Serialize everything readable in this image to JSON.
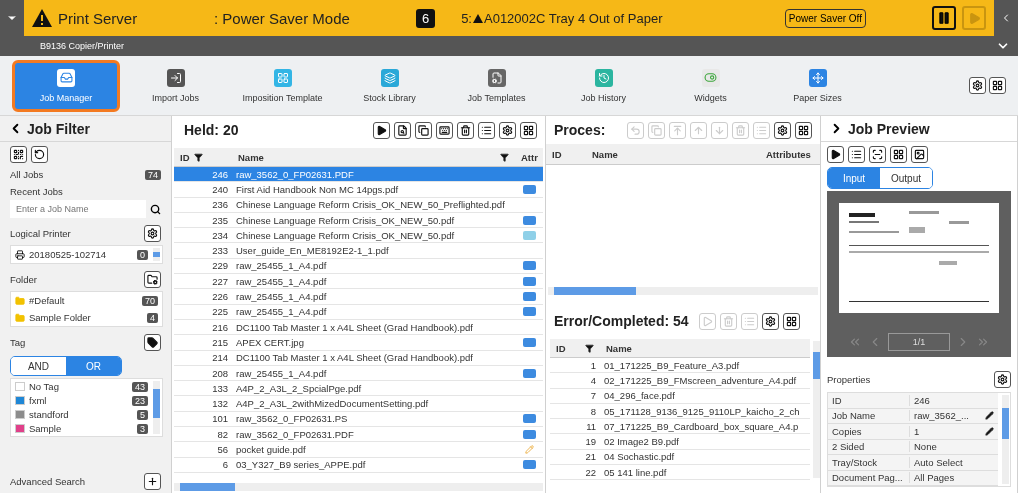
{
  "header": {
    "title": "Print Server",
    "mode": ": Power Saver Mode",
    "count": "6",
    "message_prefix": "5:",
    "message": "A012002C Tray 4 Out of Paper",
    "power_button": "Power Saver Off",
    "device": "B9136 Copier/Printer"
  },
  "toolbar": [
    {
      "label": "Job Manager",
      "kind": "manager",
      "selected": true
    },
    {
      "label": "Import Jobs",
      "kind": "import",
      "selected": false
    },
    {
      "label": "Imposition Template",
      "kind": "imposition",
      "selected": false
    },
    {
      "label": "Stock Library",
      "kind": "stock",
      "selected": false
    },
    {
      "label": "Job Templates",
      "kind": "templates",
      "selected": false
    },
    {
      "label": "Job History",
      "kind": "history",
      "selected": false
    },
    {
      "label": "Widgets",
      "kind": "widgets",
      "selected": false
    },
    {
      "label": "Paper Sizes",
      "kind": "paper",
      "selected": false
    }
  ],
  "job_filter": {
    "title": "Job Filter",
    "all_jobs": {
      "label": "All Jobs",
      "count": "74"
    },
    "recent_jobs": "Recent Jobs",
    "search_placeholder": "Enter a Job Name",
    "logical_printer": {
      "label": "Logical Printer",
      "items": [
        {
          "name": "20180525-102714",
          "count": "0"
        }
      ]
    },
    "folder": {
      "label": "Folder",
      "items": [
        {
          "name": "#Default",
          "count": "70"
        },
        {
          "name": "Sample Folder",
          "count": "4"
        }
      ]
    },
    "tag": {
      "label": "Tag",
      "modes": [
        {
          "label": "AND",
          "selected": false
        },
        {
          "label": "OR",
          "selected": true
        }
      ],
      "items": [
        {
          "name": "No Tag",
          "count": "43",
          "color": "#ffffff"
        },
        {
          "name": "fxml",
          "count": "23",
          "color": "#1f87d6"
        },
        {
          "name": "standford",
          "count": "5",
          "color": "#8c8c8c"
        },
        {
          "name": "Sample",
          "count": "3",
          "color": "#e0408a"
        }
      ]
    },
    "advanced_search": "Advanced Search"
  },
  "held": {
    "title": "Held: 20",
    "columns": [
      "ID",
      "Name",
      "Attr"
    ],
    "rows": [
      {
        "id": "246",
        "name": "raw_3562_0_FP02631.PDF",
        "kind": "plain",
        "selected": true
      },
      {
        "id": "240",
        "name": "First Aid Handbook Non MC 14pgs.pdf",
        "kind": "rdp",
        "selected": false
      },
      {
        "id": "236",
        "name": "Chinese Language Reform Crisis_OK_NEW_50_Preflighted.pdf",
        "kind": "plain",
        "selected": false
      },
      {
        "id": "235",
        "name": "Chinese Language Reform Crisis_OK_NEW_50.pdf",
        "kind": "rdp",
        "selected": false
      },
      {
        "id": "234",
        "name": "Chinese Language Reform Crisis_OK_NEW_50.pdf",
        "kind": "ps",
        "selected": false
      },
      {
        "id": "233",
        "name": "User_guide_En_ME8192E2-1_1.pdf",
        "kind": "plain",
        "selected": false
      },
      {
        "id": "229",
        "name": "raw_25455_1_A4.pdf",
        "kind": "rdp",
        "selected": false
      },
      {
        "id": "227",
        "name": "raw_25455_1_A4.pdf",
        "kind": "rdp",
        "selected": false
      },
      {
        "id": "226",
        "name": "raw_25455_1_A4.pdf",
        "kind": "rdp",
        "selected": false
      },
      {
        "id": "225",
        "name": "raw_25455_1_A4.pdf",
        "kind": "rdp",
        "selected": false
      },
      {
        "id": "216",
        "name": "DC1100 Tab Master 1 x A4L Sheet (Grad Handbook).pdf",
        "kind": "plain",
        "selected": false
      },
      {
        "id": "215",
        "name": "APEX CERT.jpg",
        "kind": "rdp",
        "selected": false
      },
      {
        "id": "214",
        "name": "DC1100 Tab Master 1 x A4L Sheet (Grad Handbook).pdf",
        "kind": "plain",
        "selected": false
      },
      {
        "id": "208",
        "name": "raw_25455_1_A4.pdf",
        "kind": "rdp",
        "selected": false
      },
      {
        "id": "133",
        "name": "A4P_2_A3L_2_SpcialPge.pdf",
        "kind": "plain",
        "selected": false
      },
      {
        "id": "132",
        "name": "A4P_2_A3L_2withMizedDocumentSetting.pdf",
        "kind": "plain",
        "selected": false
      },
      {
        "id": "101",
        "name": "raw_3562_0_FP02631.PS",
        "kind": "rdp",
        "selected": false
      },
      {
        "id": "82",
        "name": "raw_3562_0_FP02631.PDF",
        "kind": "rdp",
        "selected": false
      },
      {
        "id": "56",
        "name": "pocket guide.pdf",
        "kind": "edit",
        "selected": false
      },
      {
        "id": "6",
        "name": "03_Y327_B9 series_APPE.pdf",
        "kind": "rdp",
        "selected": false
      }
    ]
  },
  "processing": {
    "title": "Proces:",
    "columns": [
      "ID",
      "Name",
      "Attributes"
    ]
  },
  "completed": {
    "title": "Error/Completed: 54",
    "columns": [
      "ID",
      "Name"
    ],
    "rows": [
      {
        "id": "1",
        "name": "01_171225_B9_Feature_A3.pdf"
      },
      {
        "id": "4",
        "name": "02_171225_B9_FMscreen_adventure_A4.pdf"
      },
      {
        "id": "7",
        "name": "04_296_face.pdf"
      },
      {
        "id": "8",
        "name": "05_171128_9136_9125_9110LP_kaicho_2_ch"
      },
      {
        "id": "11",
        "name": "07_171225_B9_Cardboard_box_square_A4.p"
      },
      {
        "id": "19",
        "name": "02 Image2 B9.pdf"
      },
      {
        "id": "21",
        "name": "04 Sochastic.pdf"
      },
      {
        "id": "22",
        "name": "05 141 line.pdf"
      }
    ]
  },
  "preview": {
    "title": "Job Preview",
    "modes": [
      {
        "label": "Input",
        "selected": true
      },
      {
        "label": "Output",
        "selected": false
      }
    ],
    "page": "1/1",
    "properties_title": "Properties",
    "properties": [
      {
        "label": "ID",
        "value": "246",
        "editable": false
      },
      {
        "label": "Job Name",
        "value": "raw_3562_...",
        "editable": true
      },
      {
        "label": "Copies",
        "value": "1",
        "editable": true
      },
      {
        "label": "2 Sided",
        "value": "None",
        "editable": false
      },
      {
        "label": "Tray/Stock",
        "value": "Auto Select",
        "editable": false
      },
      {
        "label": "Document Pag...",
        "value": "All Pages",
        "editable": false
      }
    ]
  }
}
